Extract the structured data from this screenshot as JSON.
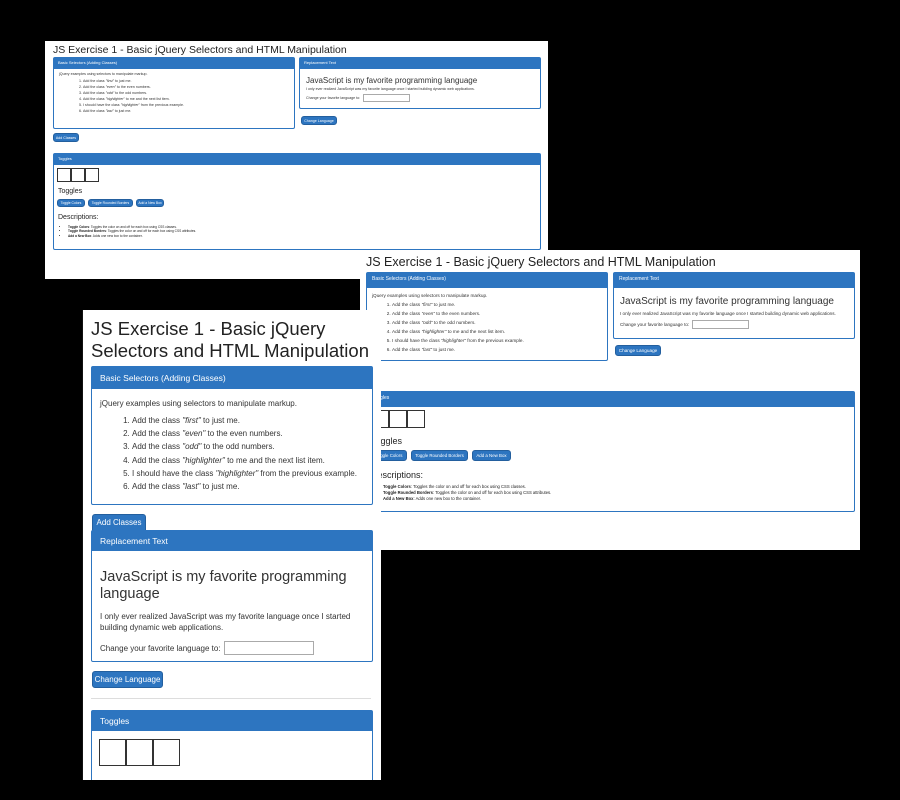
{
  "title": "JS Exercise 1 - Basic jQuery Selectors and HTML Manipulation",
  "selectors_panel": {
    "header": "Basic Selectors (Adding Classes)",
    "intro": "jQuery examples using selectors to manipulate markup.",
    "items": [
      {
        "pre": "Add the class ",
        "em": "\"first\"",
        "post": " to just me."
      },
      {
        "pre": "Add the class ",
        "em": "\"even\"",
        "post": " to the even numbers."
      },
      {
        "pre": "Add the class ",
        "em": "\"odd\"",
        "post": " to the odd numbers."
      },
      {
        "pre": "Add the class ",
        "em": "\"highlighter\"",
        "post": " to me and the next list item."
      },
      {
        "pre": "I should have the class ",
        "em": "\"highlighter\"",
        "post": " from the previous example."
      },
      {
        "pre": "Add the class ",
        "em": "\"last\"",
        "post": " to just me."
      }
    ],
    "button": "Add Classes"
  },
  "replacement_panel": {
    "header": "Replacement Text",
    "heading": "JavaScript is my favorite programming language",
    "paragraph": "I only ever realized JavaScript was my favorite language once I started building dynamic web applications.",
    "label": "Change your favorite language to:",
    "input_value": "",
    "button": "Change Language"
  },
  "toggles_panel": {
    "header": "Toggles",
    "subheading": "Toggles",
    "buttons": [
      "Toggle Colors",
      "Toggle Rounded Borders",
      "Add a New Box"
    ],
    "descriptions_heading": "Descriptions:",
    "descriptions": [
      {
        "term": "Toggle Colors",
        "text": ": Toggles the color on and off for each box using CSS classes."
      },
      {
        "term": "Toggle Rounded Borders",
        "text": ": Toggles the color on and off for each box using CSS attributes."
      },
      {
        "term": "Add a New Box",
        "text": ": Adds one new box to the container."
      }
    ]
  },
  "colors": {
    "primary": "#2d75c0",
    "background": "#000000"
  }
}
